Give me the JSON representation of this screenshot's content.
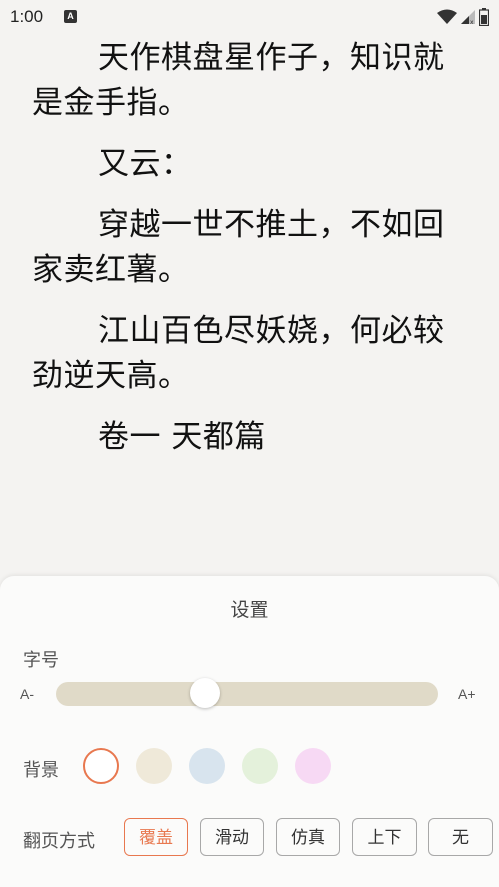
{
  "status_bar": {
    "time": "1:00",
    "notification_icon": "a-icon",
    "icons": [
      "wifi-icon",
      "signal-icon",
      "battery-icon"
    ]
  },
  "reader": {
    "paragraphs": [
      "天作棋盘星作子，知识就是金手指。",
      "又云：",
      "穿越一世不推土，不如回家卖红薯。",
      "江山百色尽妖娆，何必较劲逆天高。",
      "卷一 天都篇"
    ]
  },
  "settings": {
    "title": "设置",
    "font_size": {
      "label": "字号",
      "decrease_label": "A-",
      "increase_label": "A+",
      "value_fraction": 0.39
    },
    "background": {
      "label": "背景",
      "swatches": [
        {
          "name": "white",
          "color": "#ffffff",
          "selected": true
        },
        {
          "name": "beige",
          "color": "#efe9d9",
          "selected": false
        },
        {
          "name": "blue",
          "color": "#d8e4ee",
          "selected": false
        },
        {
          "name": "green",
          "color": "#e4f1db",
          "selected": false
        },
        {
          "name": "pink",
          "color": "#f7d9f4",
          "selected": false
        }
      ],
      "selected_ring_color": "#e8784f"
    },
    "page_turn": {
      "label": "翻页方式",
      "options": [
        "覆盖",
        "滑动",
        "仿真",
        "上下",
        "无"
      ],
      "selected": "覆盖"
    }
  },
  "colors": {
    "accent": "#e8784f",
    "slider_track": "#e0dac8"
  }
}
